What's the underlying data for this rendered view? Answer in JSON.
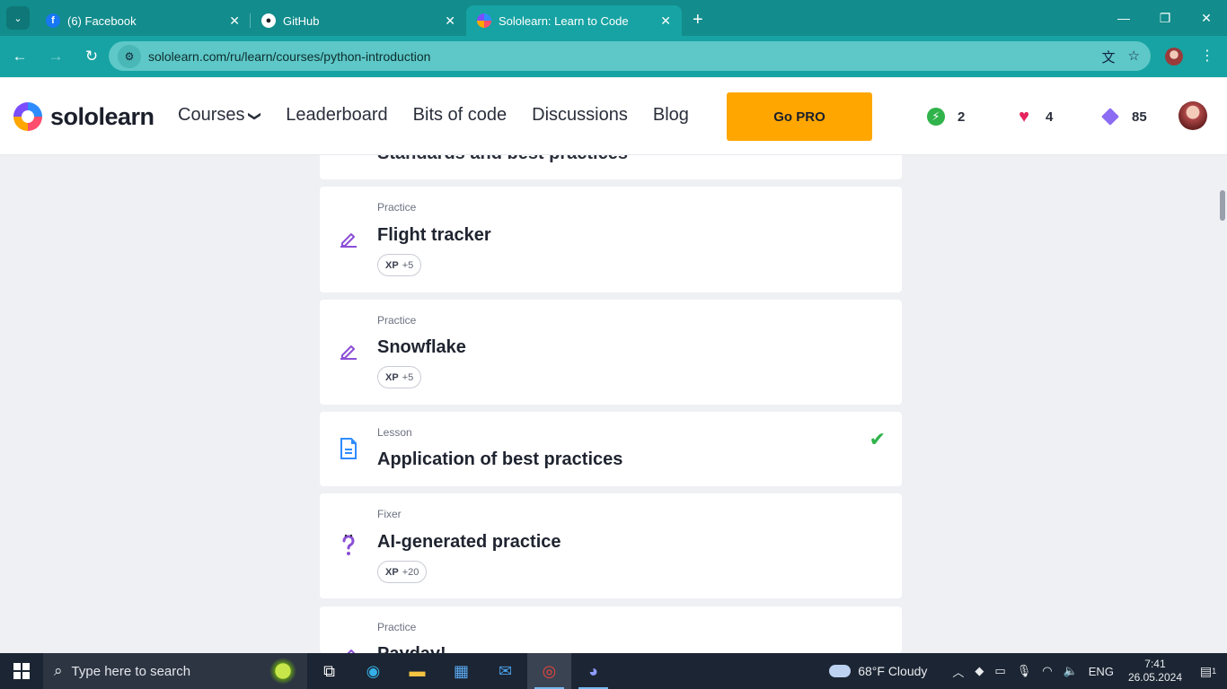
{
  "browser": {
    "tabs": [
      {
        "title": "(6) Facebook",
        "favicon": "facebook-icon",
        "active": false
      },
      {
        "title": "GitHub",
        "favicon": "github-icon",
        "active": false
      },
      {
        "title": "Sololearn: Learn to Code",
        "favicon": "sololearn-icon",
        "active": true
      }
    ],
    "url": "sololearn.com/ru/learn/courses/python-introduction"
  },
  "site": {
    "logo_text": "sololearn",
    "nav": {
      "courses": "Courses",
      "leaderboard": "Leaderboard",
      "bits_of_code": "Bits of code",
      "discussions": "Discussions",
      "blog": "Blog"
    },
    "go_pro": "Go PRO",
    "stats": {
      "streak": "2",
      "hearts": "4",
      "gems": "85"
    },
    "colors": {
      "accent": "#ffa600",
      "practice_icon": "#8c4fd6",
      "lesson_icon": "#2f8cff",
      "complete": "#2fb34a"
    }
  },
  "content": {
    "partial_top_title": "Standards and best practices",
    "items": [
      {
        "kind": "Practice",
        "title": "Flight tracker",
        "xp_label": "XP",
        "xp": "+5",
        "icon": "pencil-icon"
      },
      {
        "kind": "Practice",
        "title": "Snowflake",
        "xp_label": "XP",
        "xp": "+5",
        "icon": "pencil-icon"
      },
      {
        "kind": "Lesson",
        "title": "Application of best practices",
        "icon": "document-icon",
        "completed": true
      },
      {
        "kind": "Fixer",
        "title": "AI-generated practice",
        "xp_label": "XP",
        "xp": "+20",
        "icon": "question-bug-icon"
      },
      {
        "kind": "Practice",
        "title": "Payday!",
        "icon": "pencil-icon"
      }
    ]
  },
  "taskbar": {
    "search_placeholder": "Type here to search",
    "weather": "68°F  Cloudy",
    "language": "ENG",
    "time": "7:41",
    "date": "26.05.2024",
    "notification_count": "1"
  }
}
